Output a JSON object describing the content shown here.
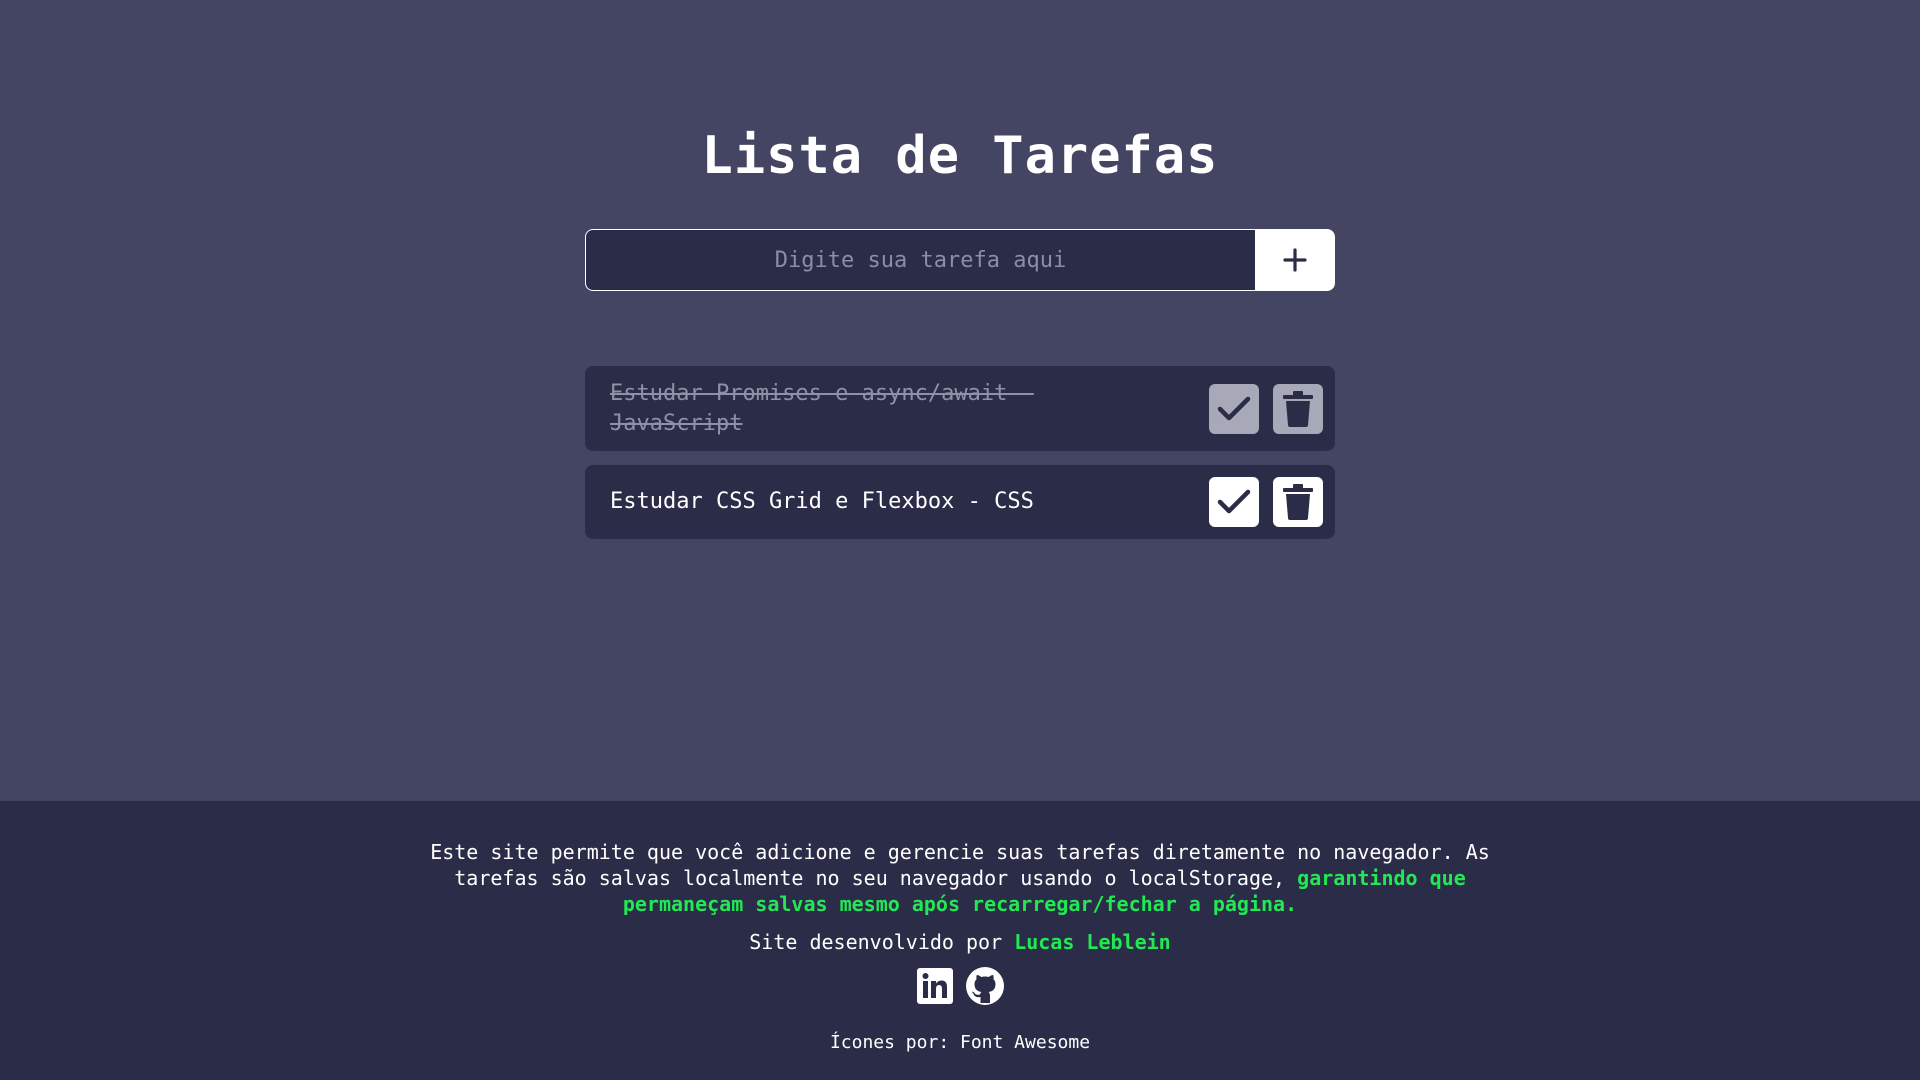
{
  "app": {
    "title": "Lista de Tarefas"
  },
  "form": {
    "placeholder": "Digite sua tarefa aqui",
    "value": ""
  },
  "tasks": [
    {
      "text": "Estudar Promises e async/await - JavaScript",
      "completed": true
    },
    {
      "text": "Estudar CSS Grid e Flexbox - CSS",
      "completed": false
    }
  ],
  "footer": {
    "about_text": "Este site permite que você adicione e gerencie suas tarefas diretamente no navegador. As tarefas são salvas localmente no seu navegador usando o localStorage,",
    "about_highlight": "garantindo que permaneçam salvas mesmo após recarregar/fechar a página.",
    "credit_text": "Site desenvolvido por",
    "credit_name": "Lucas Leblein",
    "icons_credit": "Ícones por: Font Awesome"
  },
  "icons": [
    "plus-icon",
    "check-icon",
    "trash-icon",
    "linkedin-icon",
    "github-icon"
  ],
  "colors": {
    "background": "#434563",
    "surface": "#2b2d48",
    "accent": "#22e853",
    "text": "#ffffff",
    "muted": "#8f91a6"
  }
}
